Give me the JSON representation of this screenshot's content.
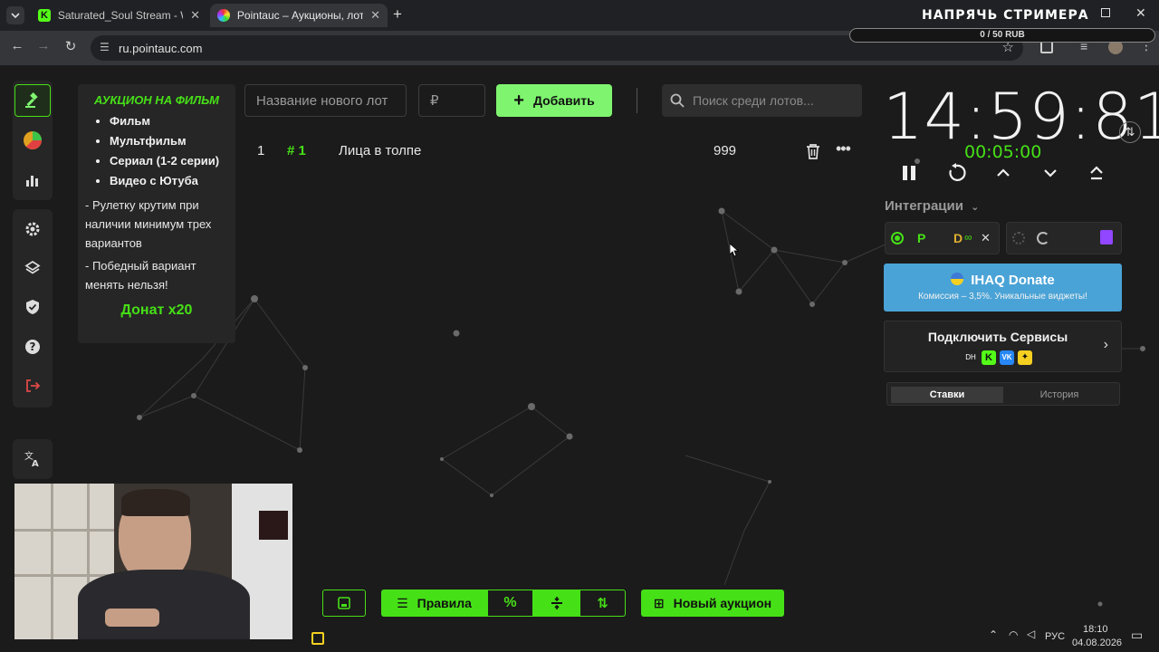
{
  "browser": {
    "tabs": [
      {
        "title": "Saturated_Soul Stream - Watch",
        "active": false
      },
      {
        "title": "Pointauc – Аукционы, лотереи",
        "active": true
      }
    ],
    "url": "ru.pointauc.com"
  },
  "overlay": {
    "goal_title": "НАПРЯЧЬ СТРИМЕРА",
    "goal_progress": "0 / 50 RUB",
    "goal_fraction": 0
  },
  "notes": {
    "title": "АУКЦИОН НА ФИЛЬМ",
    "items": [
      "Фильм",
      "Мультфильм",
      "Сериал (1-2 серии)",
      "Видео с Ютуба"
    ],
    "rule1": "- Рулетку крутим при наличии минимум трех вариантов",
    "rule2": "- Победный вариант менять нельзя!",
    "donate": "Донат x20"
  },
  "lot_form": {
    "name_placeholder": "Название нового лот",
    "amount_placeholder": "₽",
    "add_label": "Добавить",
    "search_placeholder": "Поиск среди лотов..."
  },
  "lots": [
    {
      "index": "1",
      "rank": "# 1",
      "name": "Лица в толпе",
      "amount": "999"
    }
  ],
  "timer": {
    "main": "14:59:81",
    "sub": "00:05:00"
  },
  "integrations": {
    "label": "Интеграции",
    "ihaq_title": "IHAQ Donate",
    "ihaq_subtitle": "Комиссия – 3,5%. Уникальные виджеты!",
    "services_title": "Подключить Сервисы",
    "tab_bids": "Ставки",
    "tab_history": "История"
  },
  "bottom_bar": {
    "rules_label": "Правила",
    "new_auction_label": "Новый аукцион"
  },
  "taskbar": {
    "lang": "РУС",
    "time": "18:10",
    "date": "04.08.2026"
  },
  "colors": {
    "accent_green": "#46e017",
    "button_green": "#7ff56f",
    "ihaq_blue": "#4aa3d6",
    "background": "#1b1b1b"
  }
}
